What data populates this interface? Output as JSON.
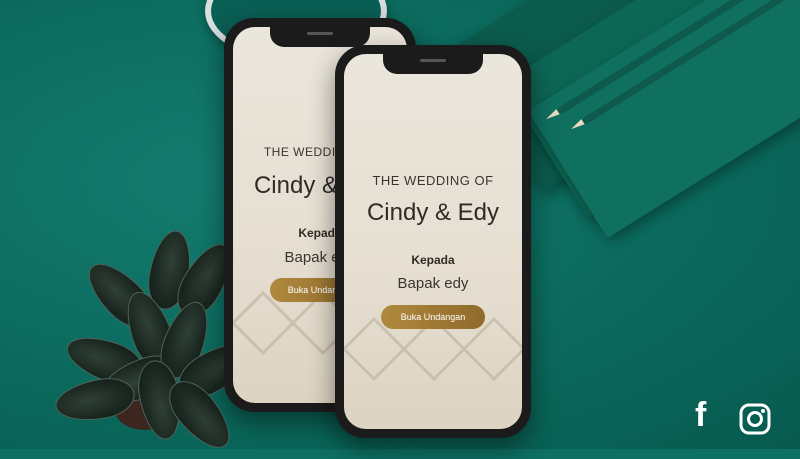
{
  "phone_back": {
    "title": "THE WEDDING OF",
    "couple": "Cindy & Edy",
    "to_label": "Kepada",
    "guest": "Bapak edy",
    "button": "Buka Undangan"
  },
  "phone_front": {
    "title": "THE WEDDING OF",
    "couple": "Cindy & Edy",
    "to_label": "Kepada",
    "guest": "Bapak edy",
    "button": "Buka Undangan"
  },
  "social": {
    "facebook": "f"
  },
  "colors": {
    "background": "#0e6f63",
    "button": "#a07a34"
  }
}
